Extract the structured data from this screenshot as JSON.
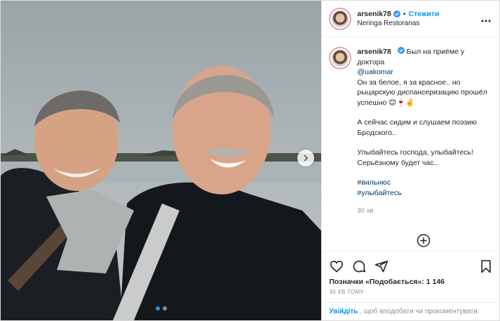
{
  "post": {
    "username": "arsenik78",
    "follow_label": "Стежити",
    "separator": "•",
    "location": "Neringa Restoranas",
    "more_icon": "more-horizontal-icon",
    "caption": {
      "lead": "Был на приёме у доктора",
      "mention": "@uakomar",
      "line2": "Он за белое, я за красное.. но рыцарскую диспансеризацию прошёл успешно 😊🍷✌️",
      "para2": "А сейчас сидим и слушаем поэзию Бродского..",
      "para3": "Улыбайтесь господа, улыбайтесь! Серьёзному будет час..",
      "hashtags": [
        "#вильнюс",
        "#улыбайтесь"
      ],
      "time_ago": "30 хв"
    },
    "likes_text": "Позначки «Подобається»: 1 146",
    "posted_time": "30 ХВ ТОМУ",
    "comment_login": "Увійдіть",
    "comment_prompt": ", щоб вподобати чи прокоментувати.",
    "carousel": {
      "total": 2,
      "active_index": 0
    }
  },
  "colors": {
    "link_blue": "#0095f6",
    "mention_blue": "#00376b",
    "muted_gray": "#8e8e8e",
    "verified_blue": "#3897f0"
  }
}
